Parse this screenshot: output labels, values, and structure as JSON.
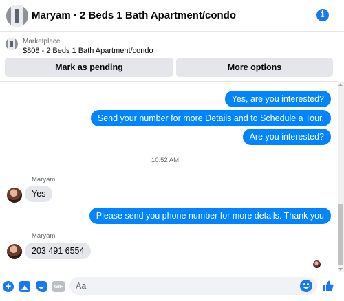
{
  "header": {
    "title": "Maryam · 2 Beds 1 Bath Apartment/condo",
    "info_icon": "info-icon"
  },
  "listing": {
    "source": "Marketplace",
    "summary": "$808 - 2 Beds 1 Bath Apartment/condo"
  },
  "actions": {
    "mark_pending": "Mark as pending",
    "more_options": "More options"
  },
  "messages": [
    {
      "from": "me",
      "text": "Yes, are you interested?"
    },
    {
      "from": "me",
      "text": "Send your number for more Details and to Schedule a Tour."
    },
    {
      "from": "me",
      "text": "Are you interested?"
    },
    {
      "from": "Maryam",
      "text": "Yes"
    },
    {
      "from": "me",
      "text": "Please send you phone number for more details. Thank you"
    },
    {
      "from": "Maryam",
      "text": "203 491 6554"
    }
  ],
  "timestamp": "10:52 AM",
  "senders": {
    "first": "Maryam",
    "second": "Maryam"
  },
  "composer": {
    "placeholder": "Aa",
    "gif_label": "GIF",
    "plus_glyph": "+",
    "icons": [
      "plus-icon",
      "photo-icon",
      "sticker-icon",
      "gif-icon",
      "emoji-icon",
      "thumbs-up-icon"
    ]
  },
  "colors": {
    "accent": "#1877f2",
    "outgoing_bubble": "#0084ff",
    "incoming_bubble": "#e4e6eb",
    "button_bg": "#e4e6eb",
    "muted_text": "#65676b"
  }
}
